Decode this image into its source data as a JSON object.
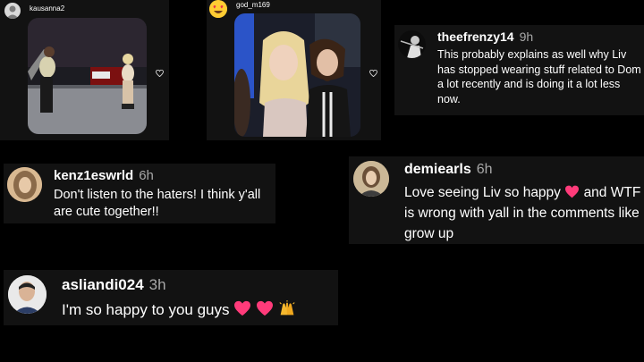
{
  "posts": [
    {
      "username": "kausanna2"
    },
    {
      "username": "god_m169"
    }
  ],
  "comments": [
    {
      "username": "theefrenzy14",
      "time": "9h",
      "text": "This probably explains as well why Liv has stopped wearing stuff related to Dom a lot recently and is doing it a lot less now."
    },
    {
      "username": "kenz1eswrld",
      "time": "6h",
      "text": "Don't listen to the haters! I think y'all are cute together!!"
    },
    {
      "username": "demiearls",
      "time": "6h",
      "text_before": "Love seeing Liv so happy",
      "text_after": "and WTF is wrong with yall in the comments like grow up"
    },
    {
      "username": "asliandi024",
      "time": "3h",
      "text": "I'm so happy to you guys"
    }
  ],
  "colors": {
    "card": "#121212",
    "meta_gray": "#a8a8a8",
    "heart_pink": "#ff3b7a"
  },
  "icons": [
    "heart-outline-icon",
    "heart-emoji",
    "raising-hands-emoji",
    "heart-eyes-emoji"
  ]
}
